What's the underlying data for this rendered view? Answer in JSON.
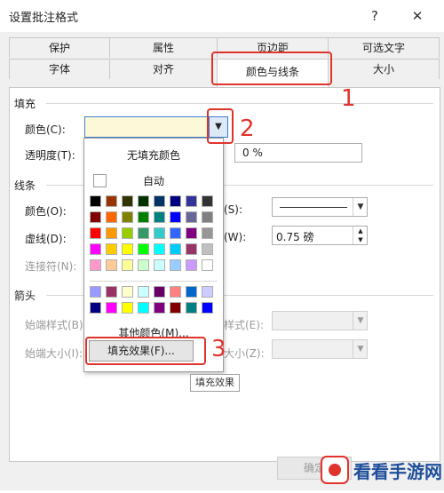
{
  "window": {
    "title": "设置批注格式",
    "help_label": "?",
    "close_label": "✕"
  },
  "tabs": {
    "row1": [
      "保护",
      "属性",
      "页边距",
      "可选文字"
    ],
    "row2": [
      "字体",
      "对齐",
      "颜色与线条",
      "大小"
    ],
    "active": "颜色与线条"
  },
  "fill": {
    "section": "填充",
    "color_label": "颜色(C):",
    "transparency_label": "透明度(T):",
    "transparency_value": "0 %",
    "color_value_hex": "#fdf8d8"
  },
  "line": {
    "section": "线条",
    "color_label": "颜色(O):",
    "dash_label": "虚线(D):",
    "connector_label": "连接符(N):",
    "style_label": "(S):",
    "weight_label": "(W):",
    "weight_value": "0.75 磅"
  },
  "arrows": {
    "section": "箭头",
    "begin_style_label": "始端样式(B)",
    "begin_size_label": "始端大小(I):",
    "end_style_label": "样式(E):",
    "end_size_label": "大小(Z):"
  },
  "popup": {
    "no_fill": "无填充颜色",
    "automatic": "自动",
    "more_colors": "其他颜色(M)...",
    "fill_effects": "填充效果(F)...",
    "palette_main": [
      [
        "#000000",
        "#993300",
        "#333300",
        "#003300",
        "#003366",
        "#000080",
        "#333399",
        "#333333"
      ],
      [
        "#800000",
        "#ff6600",
        "#808000",
        "#008000",
        "#008080",
        "#0000ff",
        "#666699",
        "#808080"
      ],
      [
        "#ff0000",
        "#ff9900",
        "#99cc00",
        "#339966",
        "#33cccc",
        "#3366ff",
        "#800080",
        "#969696"
      ],
      [
        "#ff00ff",
        "#ffcc00",
        "#ffff00",
        "#00ff00",
        "#00ffff",
        "#00ccff",
        "#993366",
        "#c0c0c0"
      ],
      [
        "#ff99cc",
        "#ffcc99",
        "#ffff99",
        "#ccffcc",
        "#ccffff",
        "#99ccff",
        "#cc99ff",
        "#ffffff"
      ]
    ],
    "palette_chart": [
      [
        "#9999ff",
        "#993366",
        "#ffffcc",
        "#ccffff",
        "#660066",
        "#ff8080",
        "#0066cc",
        "#ccccff"
      ],
      [
        "#000080",
        "#ff00ff",
        "#ffff00",
        "#00ffff",
        "#800080",
        "#800000",
        "#008080",
        "#0000ff"
      ]
    ]
  },
  "tooltip": "填充效果",
  "annotations": [
    "1",
    "2",
    "3"
  ],
  "footer": {
    "ok_label": "确定"
  },
  "watermark": {
    "text": "看看手游网"
  }
}
